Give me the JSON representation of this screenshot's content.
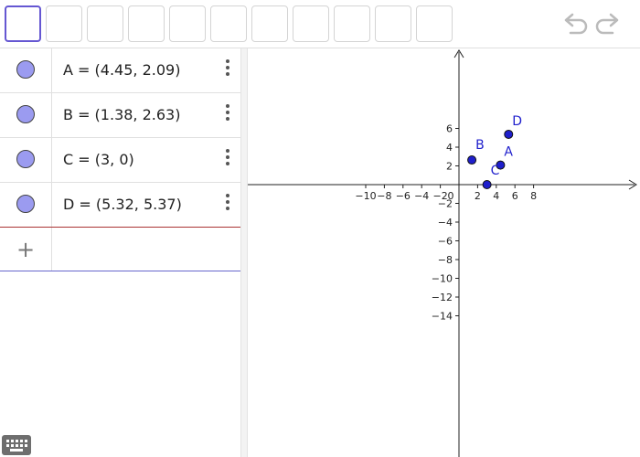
{
  "toolbar": {
    "tools": [
      "",
      "",
      "",
      "",
      "",
      "",
      "",
      "",
      "",
      "",
      ""
    ],
    "undo_icon": "undo-icon",
    "redo_icon": "redo-icon"
  },
  "algebra": {
    "items": [
      {
        "expr": "A = (4.45, 2.09)"
      },
      {
        "expr": "B = (1.38, 2.63)"
      },
      {
        "expr": "C = (3, 0)"
      },
      {
        "expr": "D = (5.32, 5.37)"
      }
    ],
    "add_icon": "+"
  },
  "colors": {
    "point": "#1f1fcc",
    "marble": "#9b9bf0",
    "accent": "#6557d2"
  },
  "graph": {
    "x_ticks": [
      "−10",
      "−8",
      "−6",
      "−4",
      "−2",
      "0",
      "2",
      "4",
      "6",
      "8"
    ],
    "y_ticks": [
      "6",
      "4",
      "2",
      "−2",
      "−4",
      "−6",
      "−8",
      "−10",
      "−12",
      "−14"
    ],
    "points": [
      {
        "label": "A",
        "x": 4.45,
        "y": 2.09
      },
      {
        "label": "B",
        "x": 1.38,
        "y": 2.63
      },
      {
        "label": "C",
        "x": 3,
        "y": 0
      },
      {
        "label": "D",
        "x": 5.32,
        "y": 5.37
      }
    ]
  }
}
